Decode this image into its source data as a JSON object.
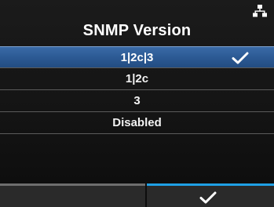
{
  "header": {
    "title": "SNMP Version",
    "status_icon": "network-icon"
  },
  "options": [
    {
      "label": "1|2c|3",
      "selected": true
    },
    {
      "label": "1|2c",
      "selected": false
    },
    {
      "label": "3",
      "selected": false
    },
    {
      "label": "Disabled",
      "selected": false
    }
  ],
  "footer": {
    "left_button": "back-button",
    "right_button": "confirm-check-icon"
  },
  "colors": {
    "selection": "#2c5a94",
    "accent": "#1fa0e6"
  }
}
